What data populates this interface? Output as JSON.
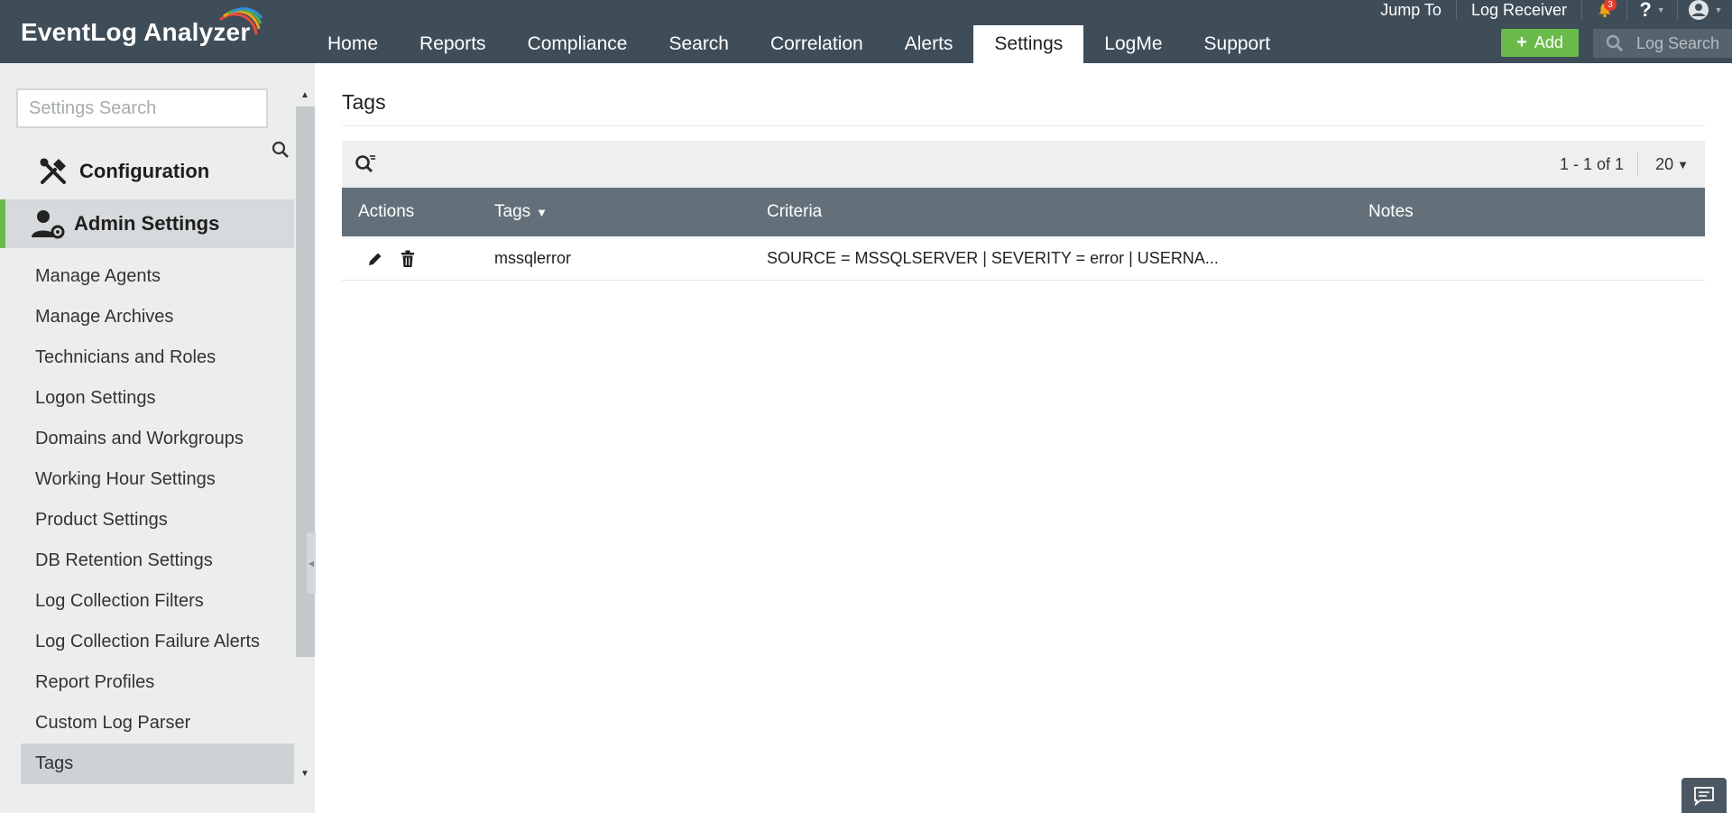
{
  "app": {
    "title": "EventLog Analyzer"
  },
  "nav": {
    "tabs": [
      {
        "label": "Home"
      },
      {
        "label": "Reports"
      },
      {
        "label": "Compliance"
      },
      {
        "label": "Search"
      },
      {
        "label": "Correlation"
      },
      {
        "label": "Alerts"
      },
      {
        "label": "Settings"
      },
      {
        "label": "LogMe"
      },
      {
        "label": "Support"
      }
    ],
    "active_tab": "Settings"
  },
  "top_links": {
    "jump_to": "Jump To",
    "log_receiver": "Log Receiver",
    "notification_count": "3",
    "help": "?"
  },
  "toolbar": {
    "add_label": "Add",
    "log_search_placeholder": "Log Search"
  },
  "sidebar": {
    "search_placeholder": "Settings Search",
    "sections": {
      "configuration": "Configuration",
      "admin_settings": "Admin Settings"
    },
    "items": [
      {
        "label": "Manage Agents"
      },
      {
        "label": "Manage Archives"
      },
      {
        "label": "Technicians and Roles"
      },
      {
        "label": "Logon Settings"
      },
      {
        "label": "Domains and Workgroups"
      },
      {
        "label": "Working Hour Settings"
      },
      {
        "label": "Product Settings"
      },
      {
        "label": "DB Retention Settings"
      },
      {
        "label": "Log Collection Filters"
      },
      {
        "label": "Log Collection Failure Alerts"
      },
      {
        "label": "Report Profiles"
      },
      {
        "label": "Custom Log Parser"
      },
      {
        "label": "Tags"
      }
    ],
    "active_item": "Tags"
  },
  "main": {
    "title": "Tags",
    "pagination": {
      "range": "1 - 1 of 1",
      "page_size": "20"
    },
    "table": {
      "columns": [
        "Actions",
        "Tags",
        "Criteria",
        "Notes"
      ],
      "rows": [
        {
          "tag": "mssqlerror",
          "criteria": "SOURCE = MSSQLSERVER | SEVERITY = error | USERNA...",
          "notes": ""
        }
      ]
    }
  },
  "colors": {
    "header_bg": "#3f4d58",
    "accent_green": "#6aba4a",
    "table_header_bg": "#647079",
    "sidebar_bg": "#eceeee"
  },
  "icons": [
    "search-icon",
    "configuration-icon",
    "admin-settings-icon",
    "edit-icon",
    "delete-icon",
    "bell-icon",
    "user-icon",
    "plus-icon",
    "sort-down-icon",
    "chat-icon"
  ]
}
